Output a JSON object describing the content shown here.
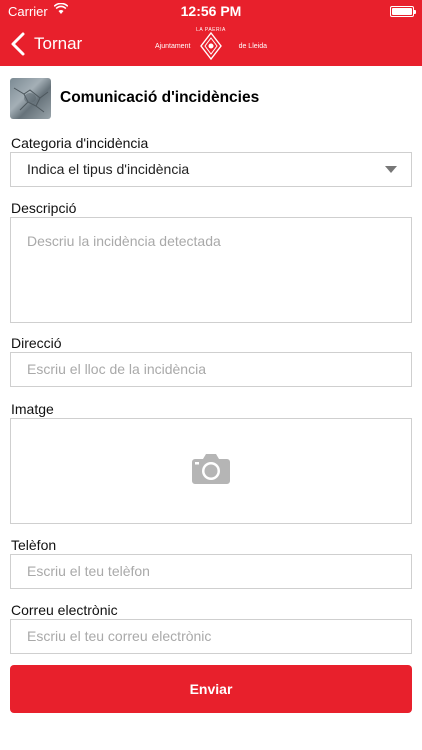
{
  "status_bar": {
    "carrier": "Carrier",
    "time": "12:56 PM"
  },
  "nav": {
    "back_label": "Tornar",
    "logo": {
      "top_text": "LA PAERIA",
      "left_text": "Ajuntament",
      "right_text": "de Lleida"
    }
  },
  "form": {
    "title": "Comunicació d'incidències",
    "category": {
      "label": "Categoria d'incidència",
      "selected": "Indica el tipus d'incidència"
    },
    "description": {
      "label": "Descripció",
      "placeholder": "Descriu la incidència detectada"
    },
    "address": {
      "label": "Direcció",
      "placeholder": "Escriu el lloc de la incidència"
    },
    "image": {
      "label": "Imatge",
      "icon": "camera-icon"
    },
    "phone": {
      "label": "Telèfon",
      "placeholder": "Escriu el teu telèfon"
    },
    "email": {
      "label": "Correu electrònic",
      "placeholder": "Escriu el teu correu electrònic"
    },
    "submit_label": "Enviar"
  },
  "colors": {
    "brand_red": "#e8202c",
    "border": "#cfcfcf",
    "placeholder": "#a9a9a9"
  }
}
